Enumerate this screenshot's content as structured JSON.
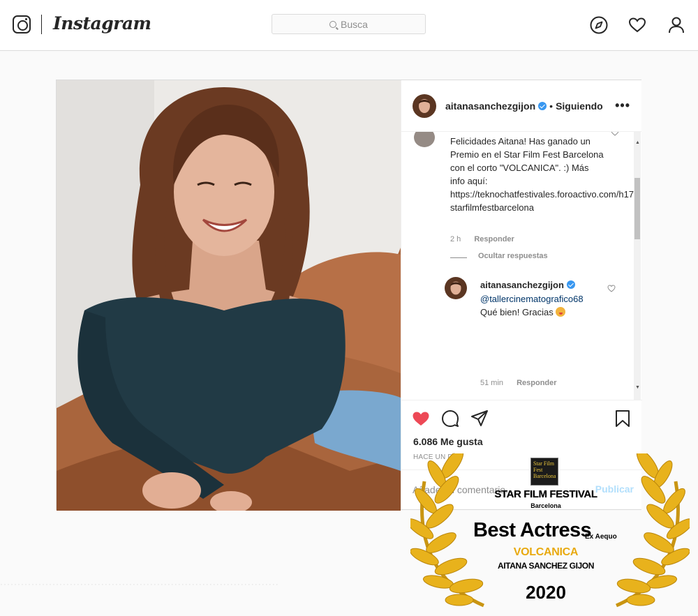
{
  "header": {
    "brand": "Instagram",
    "search_placeholder": "Busca"
  },
  "post": {
    "author": "aitanasanchezgijon",
    "separator": "•",
    "follow_status": "Siguiendo",
    "more_label": "•••",
    "comment": {
      "text": "Felicidades Aitana! Has ganado un Premio en el Star Film Fest Barcelona con el corto \"VOLCANICA\". :) Más info aquí: https://teknochatfestivales.foroactivo.com/h17-starfilmfestbarcelona",
      "time": "2 h",
      "reply_label": "Responder",
      "hide_replies": "Ocultar respuestas"
    },
    "reply": {
      "author": "aitanasanchezgijon",
      "mention": "@tallercinematografico68",
      "text": "Qué bien! Gracias",
      "time": "51 min",
      "reply_label": "Responder"
    },
    "likes": "6.086 Me gusta",
    "time_ago": "HACE UN DÍA",
    "add_comment_placeholder": "Añade un comentario...",
    "publish_label": "Publicar"
  },
  "badge": {
    "logo_text": "Star Film Fest Barcelona",
    "festival": "STAR FILM FESTIVAL",
    "city": "Barcelona",
    "award": "Best Actress",
    "award_note": "Ex Aequo",
    "film": "VOLCANICA",
    "winner": "AITANA SANCHEZ GIJON",
    "year": "2020"
  },
  "colors": {
    "like_red": "#ed4956",
    "link_blue": "#003569",
    "verified_blue": "#3897f0",
    "laurel_gold": "#e8b21c"
  },
  "icons": [
    "instagram-glyph-icon",
    "search-icon",
    "compass-icon",
    "heart-icon",
    "user-icon",
    "verified-icon",
    "more-icon",
    "like-icon",
    "comment-icon",
    "share-icon",
    "bookmark-icon",
    "laurel-icon"
  ]
}
